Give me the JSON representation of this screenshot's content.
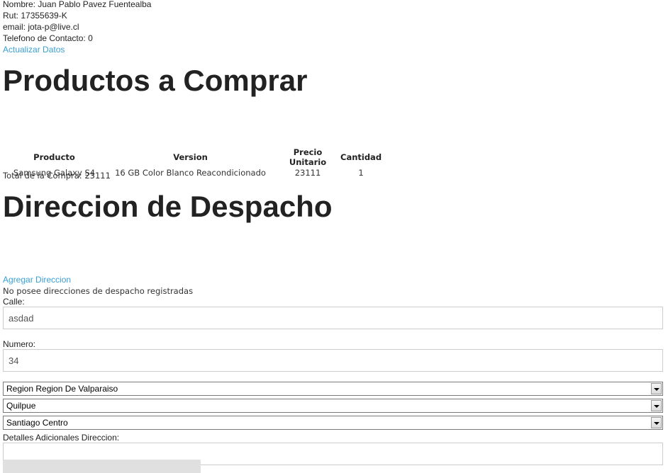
{
  "user": {
    "nombre": "Nombre: Juan Pablo Pavez Fuentealba",
    "rut": "Rut: 17355639-K",
    "email": "email: jota-p@live.cl",
    "telefono": "Telefono de Contacto: 0",
    "actualizar_link": "Actualizar Datos"
  },
  "productos": {
    "title": "Productos a Comprar",
    "headers": [
      "Producto",
      "Version",
      "Precio Unitario",
      "Cantidad"
    ],
    "rows": [
      [
        "Samsung Galaxy S4",
        "16 GB Color Blanco Reacondicionado",
        "23111",
        "1"
      ]
    ],
    "total": "Total de la Compra: 23111"
  },
  "despacho": {
    "title": "Direccion de Despacho",
    "agregar_link": "Agregar Direccion",
    "no_direcciones": "No posee direcciones de despacho registradas",
    "calle_label": "Calle:",
    "calle_value": "asdad",
    "numero_label": "Numero:",
    "numero_value": "34",
    "region_value": "Region Region De Valparaiso",
    "comuna_value": "Quilpue",
    "ciudad_value": "Santiago Centro",
    "detalles_label": "Detalles Adicionales Direccion:",
    "detalles_value": ""
  },
  "colors": {
    "link": "#3a9fd1",
    "text": "#222222",
    "border": "#cccccc"
  }
}
